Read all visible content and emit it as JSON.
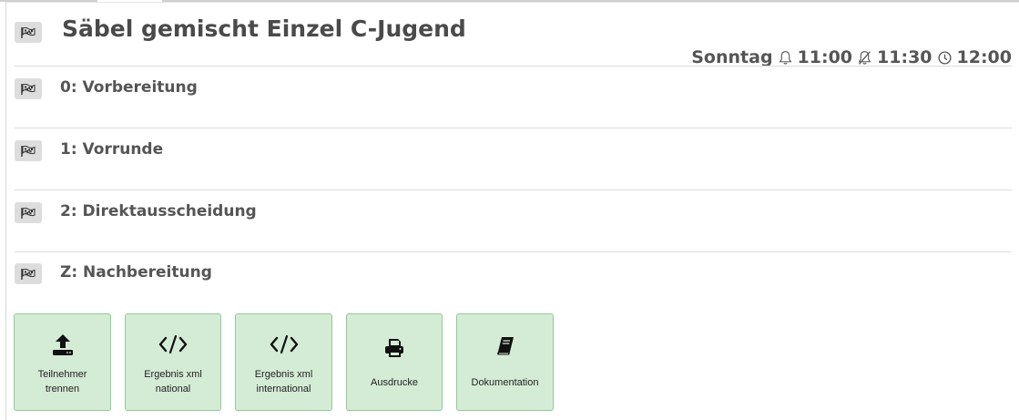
{
  "event": {
    "title": "Säbel gemischt Einzel C-Jugend",
    "day": "Sonntag",
    "times": [
      "11:00",
      "11:30",
      "12:00"
    ]
  },
  "phases": [
    {
      "label": "0: Vorbereitung"
    },
    {
      "label": "1: Vorrunde"
    },
    {
      "label": "2: Direktausscheidung"
    },
    {
      "label": "Z: Nachbereitung"
    }
  ],
  "actions": [
    {
      "label": "Teilnehmer\ntrennen",
      "icon": "upload-icon"
    },
    {
      "label": "Ergebnis xml\nnational",
      "icon": "code-icon"
    },
    {
      "label": "Ergebnis xml\ninternational",
      "icon": "code-icon"
    },
    {
      "label": "Ausdrucke",
      "icon": "printer-icon"
    },
    {
      "label": "Dokumentation",
      "icon": "book-icon"
    }
  ],
  "colors": {
    "action_bg": "#d4ecd5",
    "action_border": "#8fca94",
    "flag_button_bg": "#dddddd"
  }
}
